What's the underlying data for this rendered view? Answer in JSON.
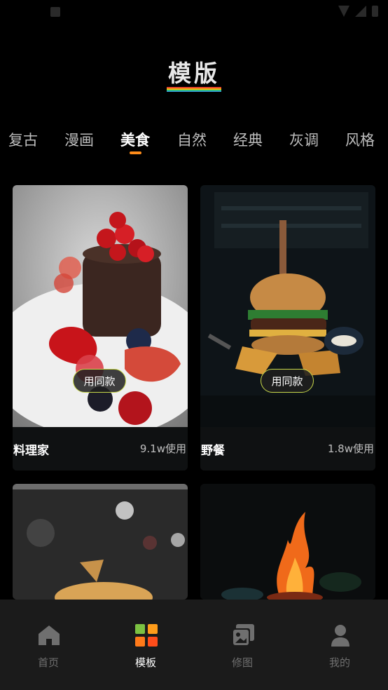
{
  "header": {
    "title": "模版"
  },
  "tabs": [
    {
      "label": "复古"
    },
    {
      "label": "漫画"
    },
    {
      "label": "美食"
    },
    {
      "label": "自然"
    },
    {
      "label": "经典"
    },
    {
      "label": "灰调"
    },
    {
      "label": "风格"
    }
  ],
  "active_tab": "美食",
  "cards": [
    {
      "name": "料理家",
      "uses": "9.1w使用",
      "button": "用同款"
    },
    {
      "name": "野餐",
      "uses": "1.8w使用",
      "button": "用同款"
    }
  ],
  "bottom_nav": [
    {
      "label": "首页",
      "icon": "home-icon"
    },
    {
      "label": "模板",
      "icon": "grid-icon"
    },
    {
      "label": "修图",
      "icon": "gallery-icon"
    },
    {
      "label": "我的",
      "icon": "person-icon"
    }
  ],
  "active_nav": "模板",
  "colors": {
    "accent": "#ff8c1a",
    "button_border": "#c8d84a",
    "background": "#000000",
    "tabbar_bg": "#1b1b1b"
  }
}
